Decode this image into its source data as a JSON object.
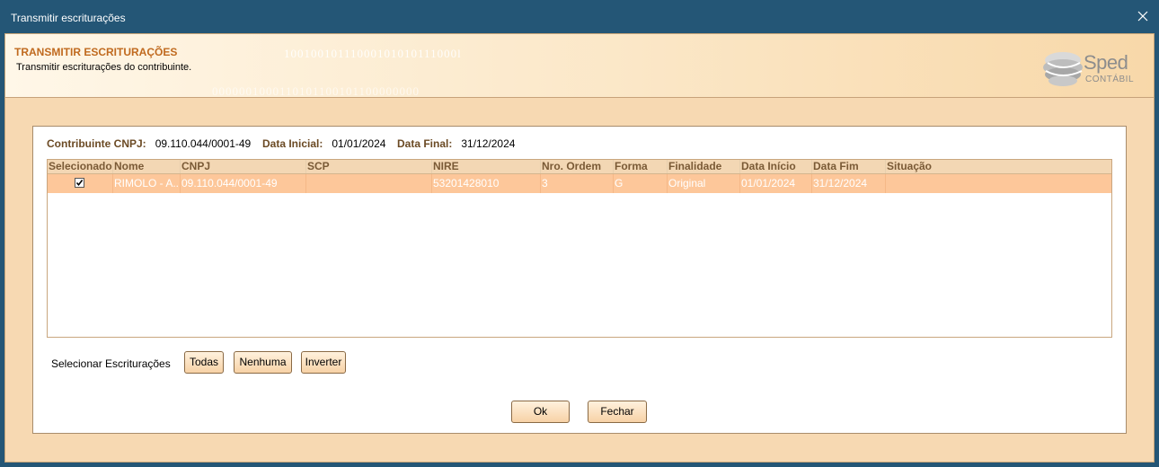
{
  "window": {
    "title": "Transmitir escriturações"
  },
  "header": {
    "title": "TRANSMITIR ESCRITURAÇÕES",
    "subtitle": "Transmitir escriturações do contribuinte.",
    "binary_top": "10010010111000101010111000l",
    "binary_bottom": "0000001000110101100101100000000",
    "logo_name": "Sped",
    "logo_sub": "CONTÁBIL"
  },
  "info": {
    "cnpj_label": "Contribuinte CNPJ:",
    "cnpj_value": "09.110.044/0001-49",
    "start_label": "Data Inicial:",
    "start_value": "01/01/2024",
    "end_label": "Data Final:",
    "end_value": "31/12/2024"
  },
  "table": {
    "columns": [
      "Selecionado",
      "Nome",
      "CNPJ",
      "SCP",
      "NIRE",
      "Nro. Ordem",
      "Forma",
      "Finalidade",
      "Data Início",
      "Data Fim",
      "Situação"
    ],
    "rows": [
      {
        "selected": true,
        "cells": [
          "RIMOLO - A...",
          "09.110.044/0001-49",
          "",
          "53201428010",
          "3",
          "G",
          "Original",
          "01/01/2024",
          "31/12/2024",
          ""
        ]
      }
    ]
  },
  "selection": {
    "label": "Selecionar Escriturações",
    "all": "Todas",
    "none": "Nenhuma",
    "invert": "Inverter"
  },
  "actions": {
    "ok": "Ok",
    "close": "Fechar"
  },
  "colors": {
    "titlebar": "#245676",
    "accent": "#c06a1f",
    "row_selected": "#fdc79a"
  },
  "icons": {
    "close": "close-icon",
    "check": "checkmark-icon",
    "logo": "sped-logo-icon"
  }
}
